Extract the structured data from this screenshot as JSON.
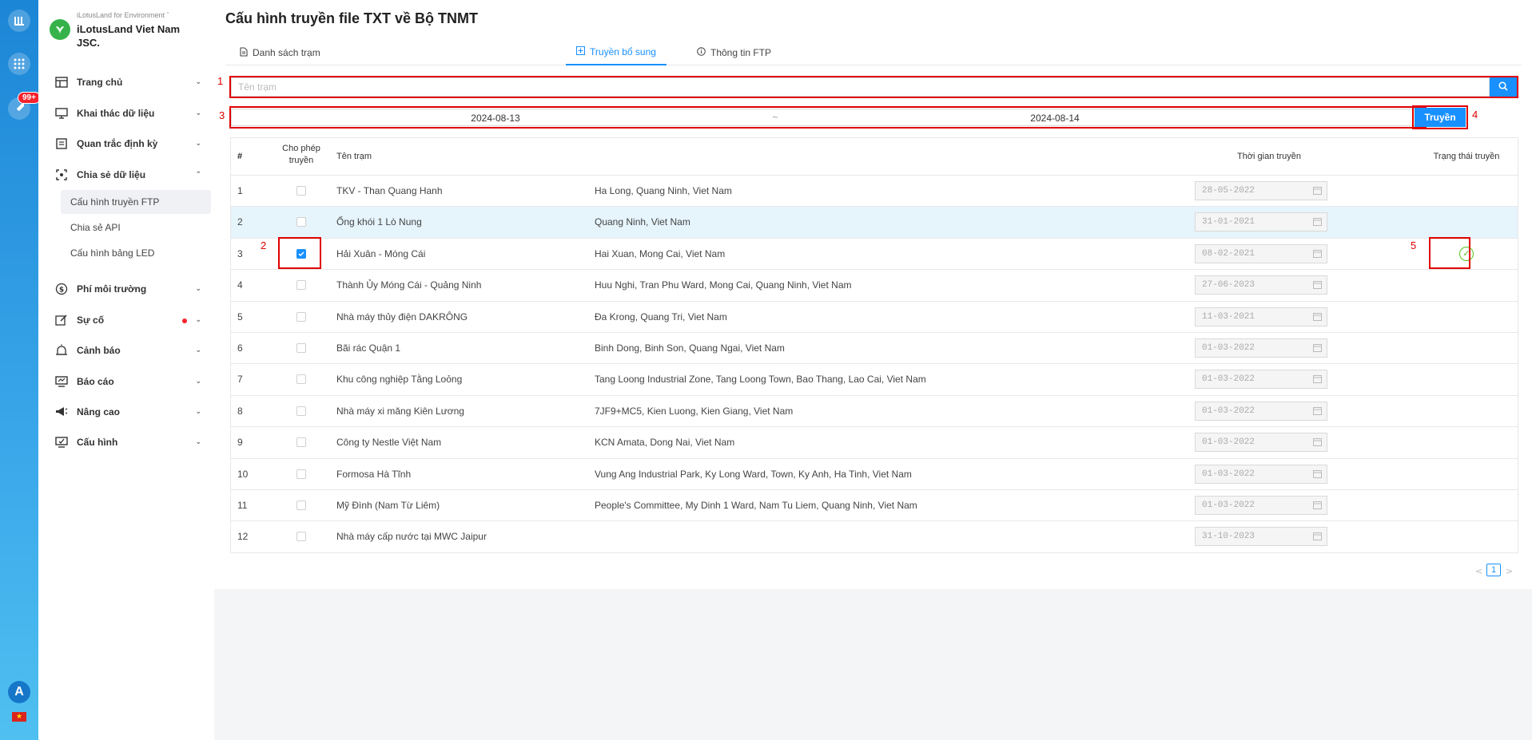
{
  "rail": {
    "badge": "99+",
    "avatar": "A",
    "flag": "★"
  },
  "brand": {
    "subtitle": "iLotusLand for Environment ˇ",
    "name": "iLotusLand Viet Nam JSC."
  },
  "menu": [
    {
      "label": "Trang chủ",
      "icon": "home-icon"
    },
    {
      "label": "Khai thác dữ liệu",
      "icon": "monitor-icon"
    },
    {
      "label": "Quan trắc định kỳ",
      "icon": "list-icon"
    },
    {
      "label": "Chia sẻ dữ liệu",
      "icon": "share-icon",
      "expanded": true
    },
    {
      "label": "Phí môi trường",
      "icon": "dollar-icon"
    },
    {
      "label": "Sự cố",
      "icon": "edit-icon",
      "dot": true
    },
    {
      "label": "Cảnh báo",
      "icon": "bell-icon"
    },
    {
      "label": "Báo cáo",
      "icon": "report-icon"
    },
    {
      "label": "Nâng cao",
      "icon": "megaphone-icon"
    },
    {
      "label": "Cấu hình",
      "icon": "config-icon"
    }
  ],
  "submenu": [
    {
      "label": "Cấu hình truyền FTP",
      "active": true
    },
    {
      "label": "Chia sẻ API"
    },
    {
      "label": "Cấu hình bảng LED"
    }
  ],
  "page": {
    "title": "Cấu hình truyền file TXT về Bộ TNMT"
  },
  "tabs": [
    {
      "label": "Danh sách trạm",
      "icon": "file-icon"
    },
    {
      "label": "Truyền bổ sung",
      "icon": "plus-square-icon",
      "active": true
    },
    {
      "label": "Thông tin FTP",
      "icon": "info-icon"
    }
  ],
  "search": {
    "placeholder": "Tên trạm",
    "value": ""
  },
  "range": {
    "start": "2024-08-13",
    "separator": "~",
    "end": "2024-08-14"
  },
  "send_button": "Truyền",
  "markers": [
    "1",
    "2",
    "3",
    "4",
    "5"
  ],
  "table": {
    "headers": {
      "index": "#",
      "allow": "Cho phép truyền",
      "name": "Tên trạm",
      "time": "Thời gian truyền",
      "status": "Trạng thái truyền"
    },
    "rows": [
      {
        "index": "1",
        "name": "TKV - Than Quang Hanh",
        "address": "Ha Long, Quang Ninh, Viet Nam",
        "date": "28-05-2022",
        "checked": false,
        "status_ok": false
      },
      {
        "index": "2",
        "name": "Ống khói 1 Lò Nung",
        "address": "Quang Ninh, Viet Nam",
        "date": "31-01-2021",
        "checked": false,
        "status_ok": false,
        "highlight": true
      },
      {
        "index": "3",
        "name": "Hải Xuân - Móng Cái",
        "address": "Hai Xuan, Mong Cai, Viet Nam",
        "date": "08-02-2021",
        "checked": true,
        "status_ok": true
      },
      {
        "index": "4",
        "name": "Thành Ủy Móng Cái - Quảng Ninh",
        "address": "Huu Nghi, Tran Phu Ward, Mong Cai, Quang Ninh, Viet Nam",
        "date": "27-06-2023",
        "checked": false,
        "status_ok": false
      },
      {
        "index": "5",
        "name": "Nhà máy thủy điện DAKRÔNG",
        "address": "Đa Krong, Quang Tri, Viet Nam",
        "date": "11-03-2021",
        "checked": false,
        "status_ok": false
      },
      {
        "index": "6",
        "name": "Bãi rác Quận 1",
        "address": "Binh Dong, Binh Son, Quang Ngai, Viet Nam",
        "date": "01-03-2022",
        "checked": false,
        "status_ok": false
      },
      {
        "index": "7",
        "name": "Khu công nghiệp Tằng Loỏng",
        "address": "Tang Loong Industrial Zone, Tang Loong Town, Bao Thang, Lao Cai, Viet Nam",
        "date": "01-03-2022",
        "checked": false,
        "status_ok": false
      },
      {
        "index": "8",
        "name": "Nhà máy xi măng Kiên Lương",
        "address": "7JF9+MC5, Kien Luong, Kien Giang, Viet Nam",
        "date": "01-03-2022",
        "checked": false,
        "status_ok": false
      },
      {
        "index": "9",
        "name": "Công ty Nestle Việt Nam",
        "address": "KCN Amata, Dong Nai, Viet Nam",
        "date": "01-03-2022",
        "checked": false,
        "status_ok": false
      },
      {
        "index": "10",
        "name": "Formosa Hà Tĩnh",
        "address": "Vung Ang Industrial Park, Ky Long Ward, Town, Ky Anh, Ha Tinh, Viet Nam",
        "date": "01-03-2022",
        "checked": false,
        "status_ok": false
      },
      {
        "index": "11",
        "name": "Mỹ Đình (Nam Từ Liêm)",
        "address": "People's Committee, My Dinh 1 Ward, Nam Tu Liem, Quang Ninh, Viet Nam",
        "date": "01-03-2022",
        "checked": false,
        "status_ok": false
      },
      {
        "index": "12",
        "name": "Nhà máy cấp nước tại MWC Jaipur",
        "address": "",
        "date": "31-10-2023",
        "checked": false,
        "status_ok": false
      }
    ]
  },
  "pagination": {
    "prev": "<",
    "current": "1",
    "next": ">"
  },
  "colors": {
    "accent": "#1890ff",
    "annotation": "#e00000",
    "success": "#52c41a",
    "brand": "#35b34a"
  }
}
